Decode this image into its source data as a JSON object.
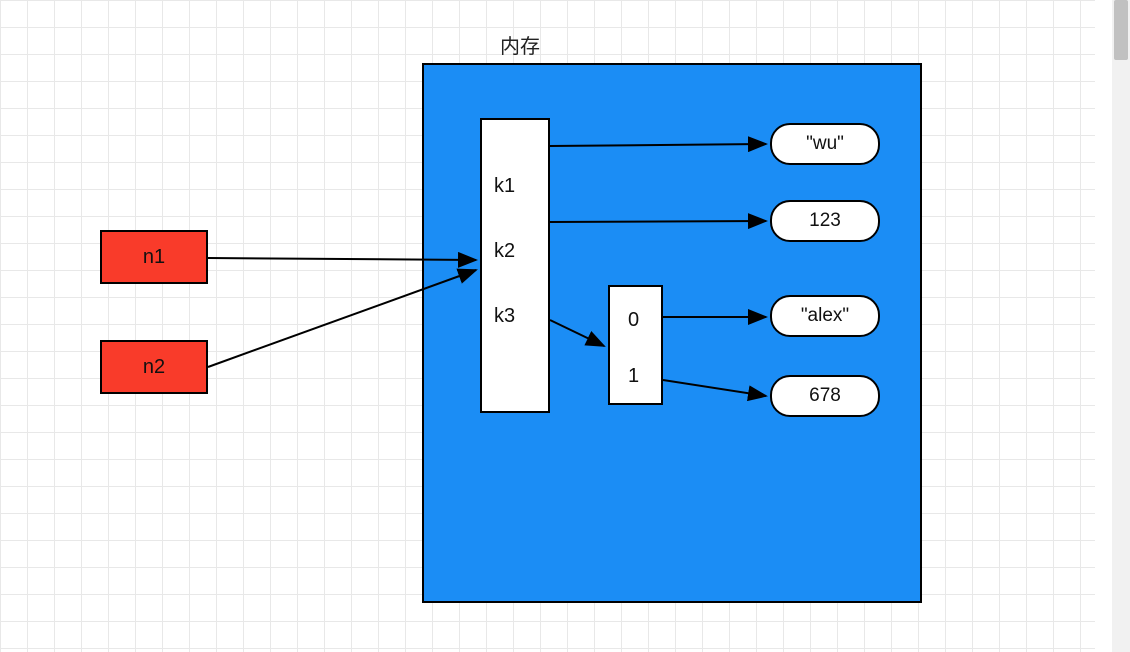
{
  "title": "内存",
  "vars": {
    "n1": "n1",
    "n2": "n2"
  },
  "keys": {
    "k1": "k1",
    "k2": "k2",
    "k3": "k3"
  },
  "indices": {
    "i0": "0",
    "i1": "1"
  },
  "values": {
    "wu": "\"wu\"",
    "num123": "123",
    "alex": "\"alex\"",
    "num678": "678"
  },
  "colors": {
    "memory_bg": "#1b8df5",
    "var_bg": "#f93b2a",
    "grid": "#e8e8e8"
  }
}
